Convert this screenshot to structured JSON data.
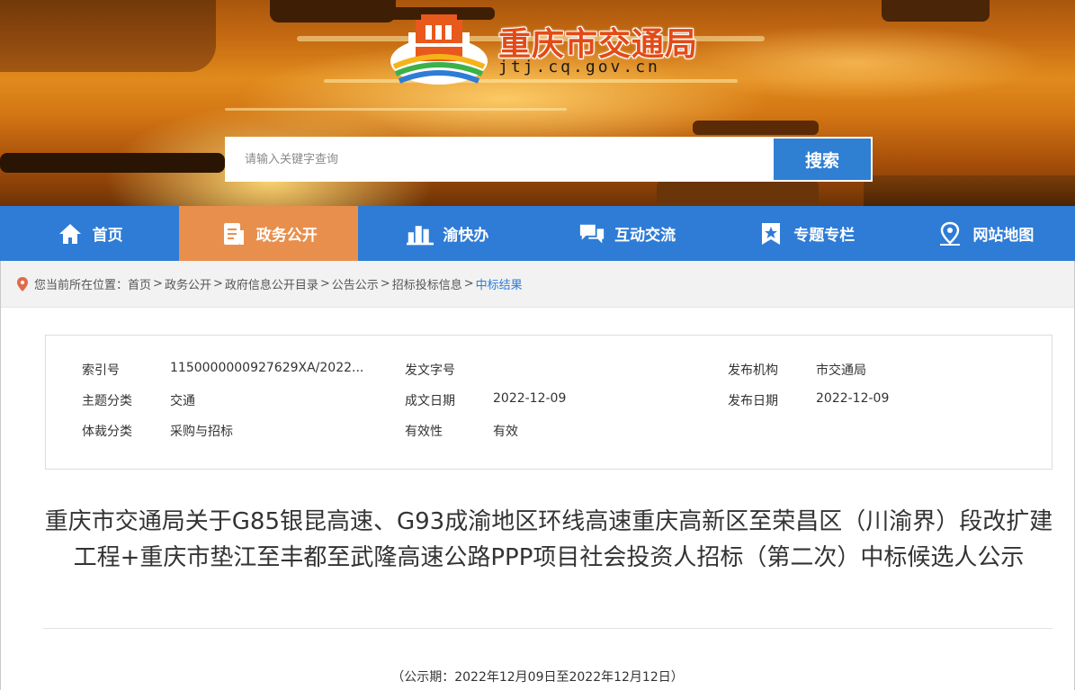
{
  "header": {
    "site_title": "重庆市交通局",
    "domain": "jtj.cq.gov.cn"
  },
  "search": {
    "placeholder": "请输入关键字查询",
    "button_label": "搜索"
  },
  "nav": {
    "items": [
      {
        "label": "首页",
        "icon": "home-icon",
        "active": false
      },
      {
        "label": "政务公开",
        "icon": "document-icon",
        "active": true
      },
      {
        "label": "渝快办",
        "icon": "buildings-icon",
        "active": false
      },
      {
        "label": "互动交流",
        "icon": "chat-icon",
        "active": false
      },
      {
        "label": "专题专栏",
        "icon": "star-bookmark-icon",
        "active": false
      },
      {
        "label": "网站地图",
        "icon": "map-pin-icon",
        "active": false
      }
    ]
  },
  "breadcrumb": {
    "prefix": "您当前所在位置：",
    "items": [
      "首页",
      "政务公开",
      "政府信息公开目录",
      "公告公示",
      "招标投标信息"
    ],
    "separator": ">",
    "current": "中标结果"
  },
  "meta": {
    "index_label": "索引号",
    "index_value": "11500000009276​29XA/2022...",
    "doc_no_label": "发文字号",
    "doc_no_value": "",
    "publisher_label": "发布机构",
    "publisher_value": "市交通局",
    "topic_label": "主题分类",
    "topic_value": "交通",
    "created_label": "成文日期",
    "created_value": "2022-12-09",
    "published_label": "发布日期",
    "published_value": "2022-12-09",
    "genre_label": "体裁分类",
    "genre_value": "采购与招标",
    "validity_label": "有效性",
    "validity_value": "有效"
  },
  "document": {
    "title": "重庆市交通局关于G85银昆高速、G93成渝地区环线高速重庆高新区至荣昌区（川渝界）段改扩建工程+重庆市垫江至丰都至武隆高速公路PPP项目社会投资人招标（第二次）中标候选人公示",
    "period": "（公示期：2022年12月09日至2022年12月12日）"
  },
  "colors": {
    "nav_bg": "#2e7cd6",
    "nav_active": "#e98f4d",
    "title_red": "#e34a16",
    "search_btn": "#2f7fd3"
  }
}
